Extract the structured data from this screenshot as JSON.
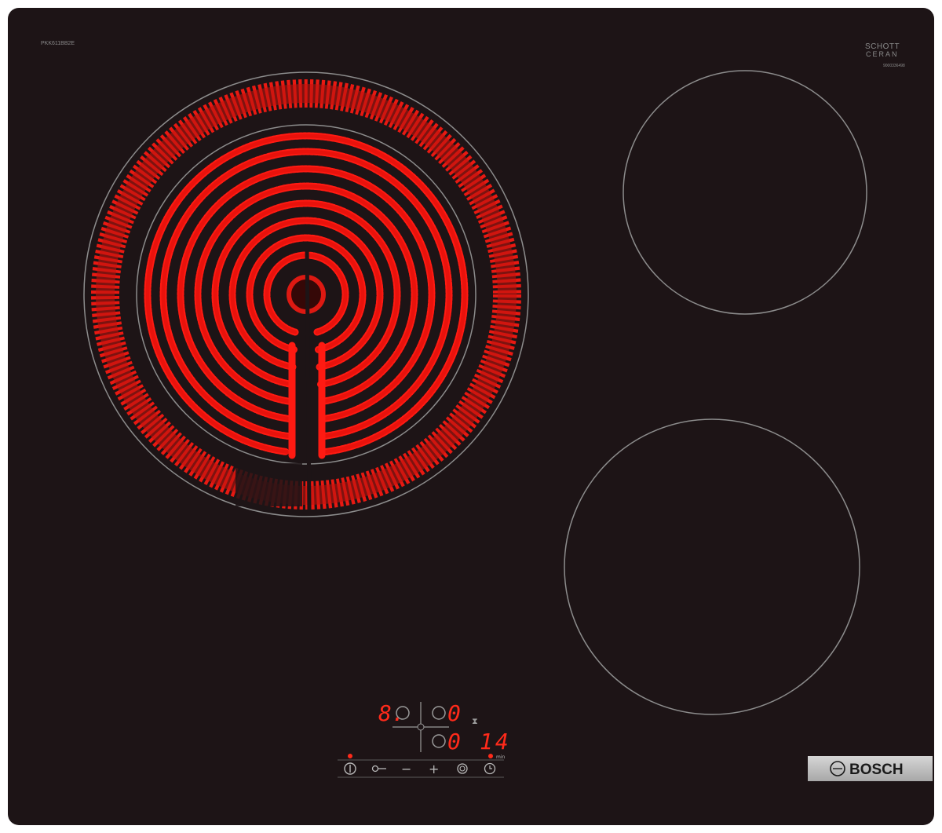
{
  "hob": {
    "model_code": "PKK611BB2E",
    "schott_line1": "SCHOTT",
    "schott_line2": "CERAN",
    "serial_code": "9000336498",
    "brand": "BOSCH",
    "colors": {
      "glass": "#1d1416",
      "glow": "#ff1a12",
      "ring": "#8c8c8c",
      "display": "#ff2a1a",
      "badge": "#c4c4c4"
    }
  },
  "zones": [
    {
      "name": "front-left",
      "state": "glowing"
    },
    {
      "name": "rear-right",
      "state": "off"
    },
    {
      "name": "front-right",
      "state": "off"
    }
  ],
  "display": {
    "zone_level_a": "8.",
    "zone_level_b": "0",
    "zone_level_c": "0",
    "timer_value": "14",
    "timer_unit": "min"
  },
  "controls": [
    {
      "name": "power-button",
      "icon": "power-icon"
    },
    {
      "name": "child-lock-button",
      "icon": "key-icon"
    },
    {
      "name": "minus-button",
      "icon": "minus-icon",
      "label": "−"
    },
    {
      "name": "plus-button",
      "icon": "plus-icon",
      "label": "+"
    },
    {
      "name": "zone-select-button",
      "icon": "zone-icon"
    },
    {
      "name": "timer-button",
      "icon": "clock-icon"
    }
  ]
}
